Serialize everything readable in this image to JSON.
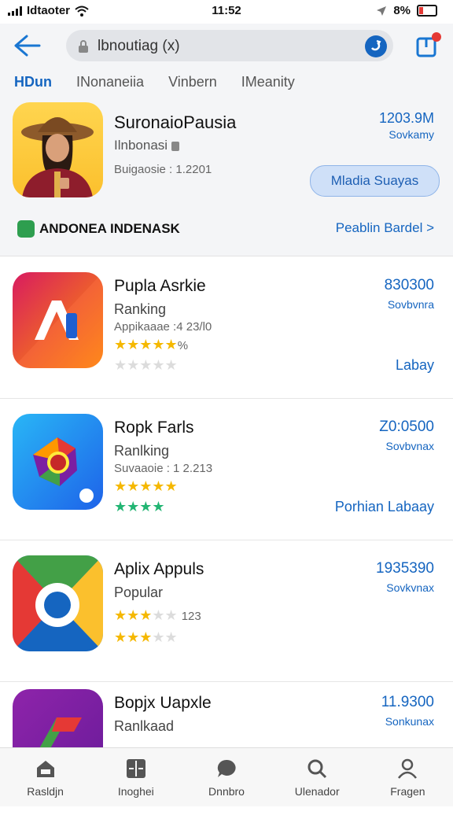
{
  "status_bar": {
    "carrier": "Idtaoter",
    "time": "11:52",
    "battery": "8%"
  },
  "search": {
    "value": "lbnoutiag (x)"
  },
  "tabs": [
    {
      "label": "HDun",
      "active": true
    },
    {
      "label": "INonaneiia",
      "active": false
    },
    {
      "label": "Vinbern",
      "active": false
    },
    {
      "label": "IMeanity",
      "active": false
    }
  ],
  "featured": {
    "name": "SuronaioPausia",
    "subtitle": "Ilnbonasi",
    "meta": "Buigaosie : 1.2201",
    "price": "1203.9M",
    "price_unit": "Sovkamy",
    "button": "Mladia Suayas",
    "badge": "ANDONEA INDENASK",
    "link": "Peablin Bardel >"
  },
  "apps": [
    {
      "name": "Pupla Asrkie",
      "category": "Ranking",
      "meta": "Appikaaae :4 23/l0",
      "stars_gold": 5,
      "rating_suffix": "%",
      "stars_second": {
        "filled": 0,
        "color": "gold"
      },
      "stars_second_text": "",
      "price": "830300",
      "unit": "Sovbvnra",
      "action": "Labay"
    },
    {
      "name": "Ropk Farls",
      "category": "Ranlking",
      "meta": "Suvaaoie : 1 2.213",
      "stars_gold": 5,
      "rating_suffix": "",
      "stars_second": {
        "filled": 4,
        "color": "green"
      },
      "stars_second_text": "",
      "price": "Z0:0500",
      "unit": "Sovbvnax",
      "action": "Porhian Labaay"
    },
    {
      "name": "Aplix Appuls",
      "category": "Popular",
      "meta": "",
      "stars_gold": 3,
      "rating_suffix": "",
      "stars_second": {
        "filled": 3,
        "color": "gold"
      },
      "stars_second_text": "123",
      "price": "1935390",
      "unit": "Sovkvnax",
      "action": ""
    },
    {
      "name": "Bopjx Uapxle",
      "category": "Ranlkaad",
      "meta": "",
      "stars_gold": 0,
      "rating_suffix": "",
      "stars_second": {
        "filled": 0,
        "color": "gold"
      },
      "stars_second_text": "",
      "price": "11.9300",
      "unit": "Sonkunax",
      "action": ""
    }
  ],
  "nav": [
    {
      "label": "Rasldjn",
      "icon": "home-icon"
    },
    {
      "label": "Inoghei",
      "icon": "apps-icon"
    },
    {
      "label": "Dnnbro",
      "icon": "chat-icon"
    },
    {
      "label": "Ulenador",
      "icon": "search-icon"
    },
    {
      "label": "Fragen",
      "icon": "profile-icon"
    }
  ],
  "colors": {
    "accent": "#1565c0",
    "star": "#f5b800",
    "green": "#22b573"
  }
}
